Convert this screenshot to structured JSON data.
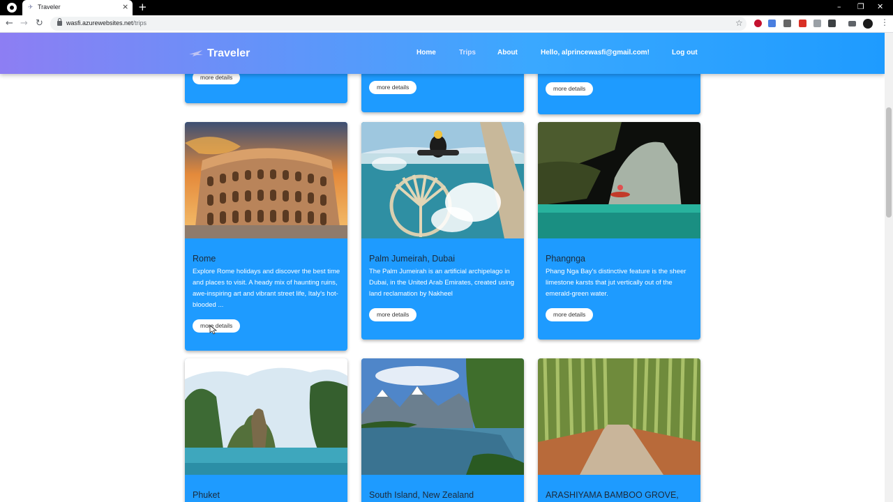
{
  "browser": {
    "tab_title": "Traveler",
    "tab_favicon": "plane-icon",
    "url_host": "wasfi.azurewebsites.net",
    "url_path": "/trips",
    "new_tab_label": "+",
    "close_tab_label": "×",
    "back_icon": "←",
    "forward_icon": "→",
    "reload_icon": "↻",
    "star_icon": "☆",
    "menu_icon": "⋮",
    "minimize_icon": "–",
    "restore_icon": "❐",
    "close_window_icon": "✕"
  },
  "nav": {
    "brand": "Traveler",
    "links": [
      {
        "label": "Home",
        "active": false
      },
      {
        "label": "Trips",
        "active": true
      },
      {
        "label": "About",
        "active": false
      },
      {
        "label": "Hello, alprincewasfi@gmail.com!",
        "active": false
      },
      {
        "label": "Log out",
        "active": false
      }
    ]
  },
  "colors": {
    "card_bg": "#1e9bff",
    "nav_gradient_start": "#8d7ef3",
    "nav_gradient_end": "#1e9bff"
  },
  "trips": [
    {
      "title": "",
      "description": "",
      "button": "more details"
    },
    {
      "title": "",
      "description": "",
      "button": "more details"
    },
    {
      "title": "",
      "description": "",
      "button": "more details"
    },
    {
      "title": "Rome",
      "description": "Explore Rome holidays and discover the best time and places to visit. A heady mix of haunting ruins, awe-inspiring art and vibrant street life, Italy's hot-blooded ...",
      "button": "more details"
    },
    {
      "title": "Palm Jumeirah, Dubai",
      "description": "The Palm Jumeirah is an artificial archipelago in Dubai, in the United Arab Emirates, created using land reclamation by Nakheel",
      "button": "more details"
    },
    {
      "title": "Phangnga",
      "description": "Phang Nga Bay's distinctive feature is the sheer limestone karsts that jut vertically out of the emerald-green water.",
      "button": "more details"
    },
    {
      "title": "Phuket",
      "description": "",
      "button": ""
    },
    {
      "title": "South Island, New Zealand",
      "description": "",
      "button": ""
    },
    {
      "title": "ARASHIYAMA BAMBOO GROVE,",
      "description": "",
      "button": ""
    }
  ]
}
